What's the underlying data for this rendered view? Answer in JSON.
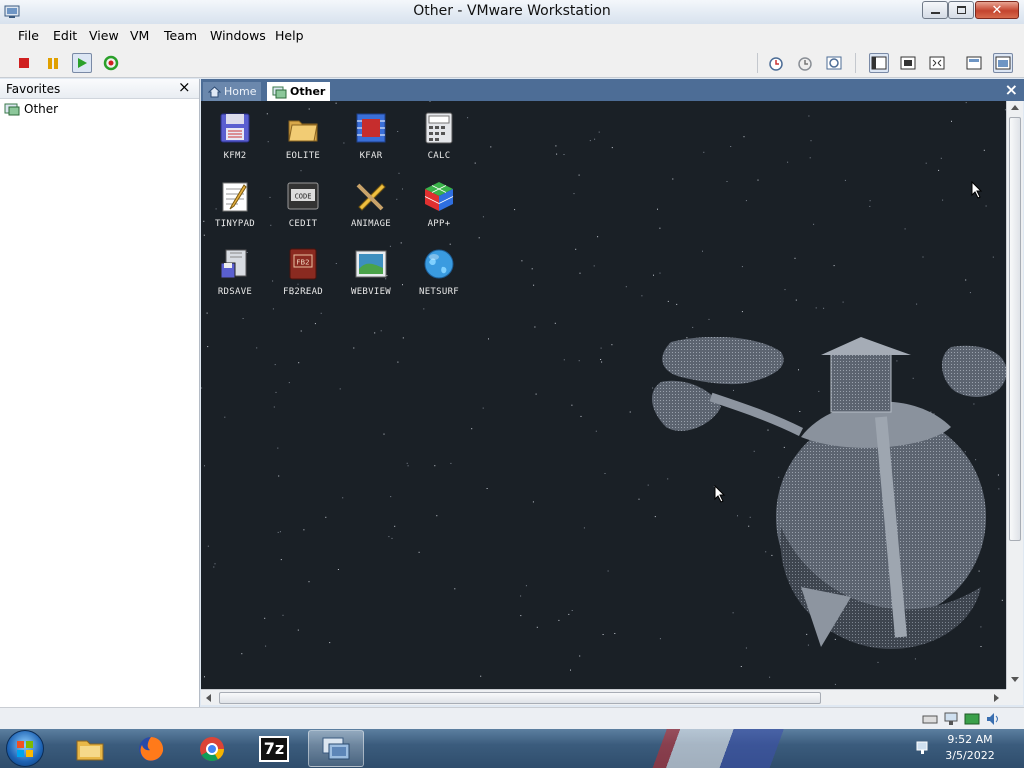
{
  "window": {
    "title": "Other - VMware Workstation"
  },
  "menu": [
    "File",
    "Edit",
    "View",
    "VM",
    "Team",
    "Windows",
    "Help"
  ],
  "sidebar": {
    "title": "Favorites",
    "close": "×",
    "items": [
      {
        "label": "Other"
      }
    ]
  },
  "tabs": [
    {
      "label": "Home"
    },
    {
      "label": "Other"
    }
  ],
  "tab_close": "×",
  "desktop_icons": [
    {
      "label": "KFM2",
      "icon": "floppy-disk-icon"
    },
    {
      "label": "EOLITE",
      "icon": "folder-icon"
    },
    {
      "label": "KFAR",
      "icon": "chip-icon"
    },
    {
      "label": "CALC",
      "icon": "calculator-icon"
    },
    {
      "label": "TINYPAD",
      "icon": "notepad-icon"
    },
    {
      "label": "CEDIT",
      "icon": "code-editor-icon"
    },
    {
      "label": "ANIMAGE",
      "icon": "pencil-ruler-icon"
    },
    {
      "label": "APP+",
      "icon": "rubik-cube-icon"
    },
    {
      "label": "RDSAVE",
      "icon": "disk-save-icon"
    },
    {
      "label": "FB2READ",
      "icon": "book-icon"
    },
    {
      "label": "WEBVIEW",
      "icon": "picture-icon"
    },
    {
      "label": "NETSURF",
      "icon": "globe-icon"
    }
  ],
  "clock": {
    "time": "9:52 AM",
    "date": "3/5/2022"
  },
  "colors": {
    "vm_background": "#1a2026",
    "tab_bar": "#4d6d96",
    "taskbar": "#3b5c7d"
  }
}
